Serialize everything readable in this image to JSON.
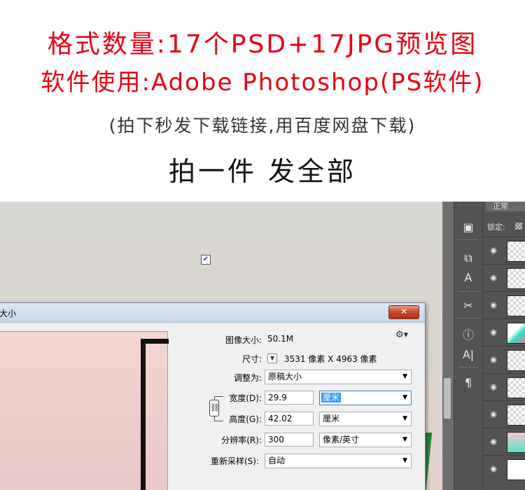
{
  "promo": {
    "line1": "格式数量:17个PSD+17JPG预览图",
    "line2": "软件使用:Adobe Photoshop(PS软件)",
    "line3": "(拍下秒发下载链接,用百度网盘下载)",
    "line4": "拍一件 发全部"
  },
  "dialog": {
    "title": "大小",
    "close_label": "✕",
    "image_size_label": "图像大小:",
    "image_size_value": "50.1M",
    "dimensions_label": "尺寸:",
    "dimensions_value": "3531 像素 X 4963 像素",
    "fit_to_label": "调整为:",
    "fit_to_value": "原稿大小",
    "width_label": "宽度(D):",
    "width_value": "29.9",
    "width_unit": "厘米",
    "height_label": "高度(G):",
    "height_value": "42.02",
    "height_unit": "厘米",
    "resolution_label": "分辨率(R):",
    "resolution_value": "300",
    "resolution_unit": "像素/英寸",
    "resample_label": "重新采样(S):",
    "resample_value": "自动",
    "resample_checked": true
  },
  "ps_panel": {
    "blend_mode": "正常",
    "lock_label": "锁定:",
    "tool_icons": [
      "cube-icon",
      "transform-icon",
      "type-transform-icon",
      "scissors-icon",
      "info-icon",
      "character-icon",
      "paragraph-icon"
    ],
    "layer_count": 9
  },
  "colors": {
    "promo_red": "#e60012",
    "selection_blue": "#3399ff",
    "ps_panel_gray": "#535353"
  }
}
